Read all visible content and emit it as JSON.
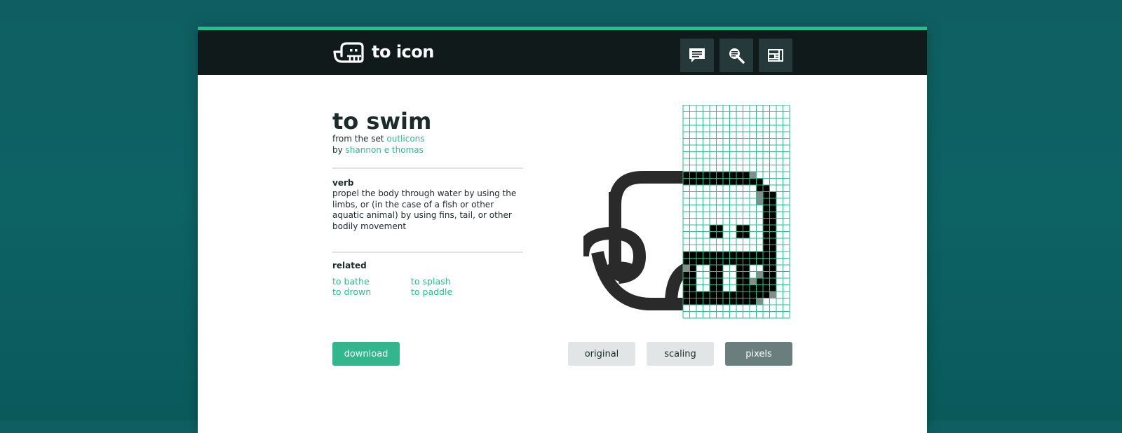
{
  "app": {
    "name": "to icon"
  },
  "header": {
    "buttons": [
      {
        "icon": "comment-icon"
      },
      {
        "icon": "search-icon"
      },
      {
        "icon": "newspaper-icon"
      }
    ]
  },
  "icon": {
    "title": "to swim",
    "set_prefix": "from the set ",
    "set_name": "outlicons",
    "author_prefix": "by ",
    "author_name": "shannon e thomas",
    "part_of_speech": "verb",
    "definition": "propel the body through water by using the limbs, or (in the case of a fish or other aquatic animal) by using fins, tail, or other bodily movement"
  },
  "related": {
    "heading": "related",
    "items": [
      "to bathe",
      "to splash",
      "to drown",
      "to paddle"
    ]
  },
  "actions": {
    "download_label": "download",
    "views": [
      "original",
      "scaling",
      "pixels"
    ],
    "active_view": "pixels"
  },
  "colors": {
    "accent": "#2fb98d",
    "header_bg": "#111a1b",
    "header_button_bg": "#26393a",
    "text": "#1c2a2a",
    "active_view_bg": "#6a7e7e",
    "inactive_view_bg": "#e1e5e5",
    "grid_line": "#2fb98d"
  }
}
